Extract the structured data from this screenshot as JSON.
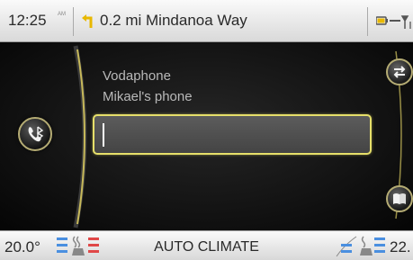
{
  "status_bar": {
    "time": "12:25",
    "ampm": "AM",
    "navigation_text": "0.2 mi Mindanoa Way",
    "icons": [
      "turn-left-arrow-icon",
      "phone-battery-signal-icon"
    ]
  },
  "phone": {
    "operator": "Vodaphone",
    "device": "Mikael's phone",
    "number_value": "",
    "icons": [
      "bluetooth-phone-icon",
      "swap-arrows-icon",
      "phonebook-icon"
    ]
  },
  "climate": {
    "left_temp": "20.0°",
    "label": "AUTO CLIMATE",
    "right_temp": "22.",
    "icons": [
      "seat-heat-left-icon",
      "seat-heat-right-icon"
    ]
  },
  "colors": {
    "accent_yellow": "#e6df6a",
    "ring_gold": "#b5ac74",
    "heat_red": "#e04848",
    "cool_blue": "#4a8fe0"
  }
}
